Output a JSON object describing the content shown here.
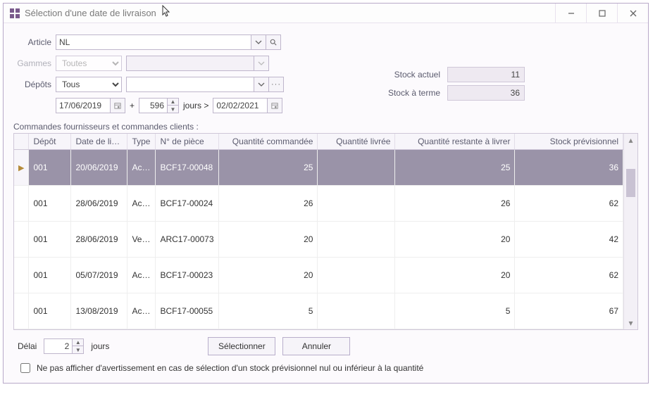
{
  "window": {
    "title": "Sélection d'une date de livraison"
  },
  "labels": {
    "article": "Article",
    "gammes": "Gammes",
    "depots": "Dépôts",
    "jours_sup": "jours >",
    "plus": "+",
    "stock_actuel": "Stock actuel",
    "stock_terme": "Stock à terme",
    "section": "Commandes fournisseurs et commandes clients :",
    "delai": "Délai",
    "jours": "jours",
    "selectionner": "Sélectionner",
    "annuler": "Annuler",
    "no_warn": "Ne pas afficher d'avertissement en cas de sélection d'un stock prévisionnel nul ou inférieur à la quantité"
  },
  "fields": {
    "article": "NL",
    "gammes": "Toutes",
    "gammes_detail": "",
    "depots": "Tous",
    "depots_detail": "",
    "date_from": "17/06/2019",
    "days": "596",
    "date_to": "02/02/2021",
    "stock_actuel": "11",
    "stock_terme": "36",
    "delai": "2"
  },
  "columns": {
    "depot": "Dépôt",
    "date": "Date de li…",
    "type": "Type",
    "piece": "N° de pièce",
    "cmd": "Quantité commandée",
    "livree": "Quantité livrée",
    "reste": "Quantité restante à livrer",
    "prev": "Stock prévisionnel"
  },
  "rows": [
    {
      "sel": true,
      "depot": "001",
      "date": "20/06/2019",
      "type": "Ac…",
      "piece": "BCF17-00048",
      "cmd": "25",
      "livree": "",
      "reste": "25",
      "prev": "36"
    },
    {
      "sel": false,
      "depot": "001",
      "date": "28/06/2019",
      "type": "Ac…",
      "piece": "BCF17-00024",
      "cmd": "26",
      "livree": "",
      "reste": "26",
      "prev": "62"
    },
    {
      "sel": false,
      "depot": "001",
      "date": "28/06/2019",
      "type": "Ve…",
      "piece": "ARC17-00073",
      "cmd": "20",
      "livree": "",
      "reste": "20",
      "prev": "42"
    },
    {
      "sel": false,
      "depot": "001",
      "date": "05/07/2019",
      "type": "Ac…",
      "piece": "BCF17-00023",
      "cmd": "20",
      "livree": "",
      "reste": "20",
      "prev": "62"
    },
    {
      "sel": false,
      "depot": "001",
      "date": "13/08/2019",
      "type": "Ac…",
      "piece": "BCF17-00055",
      "cmd": "5",
      "livree": "",
      "reste": "5",
      "prev": "67"
    }
  ]
}
